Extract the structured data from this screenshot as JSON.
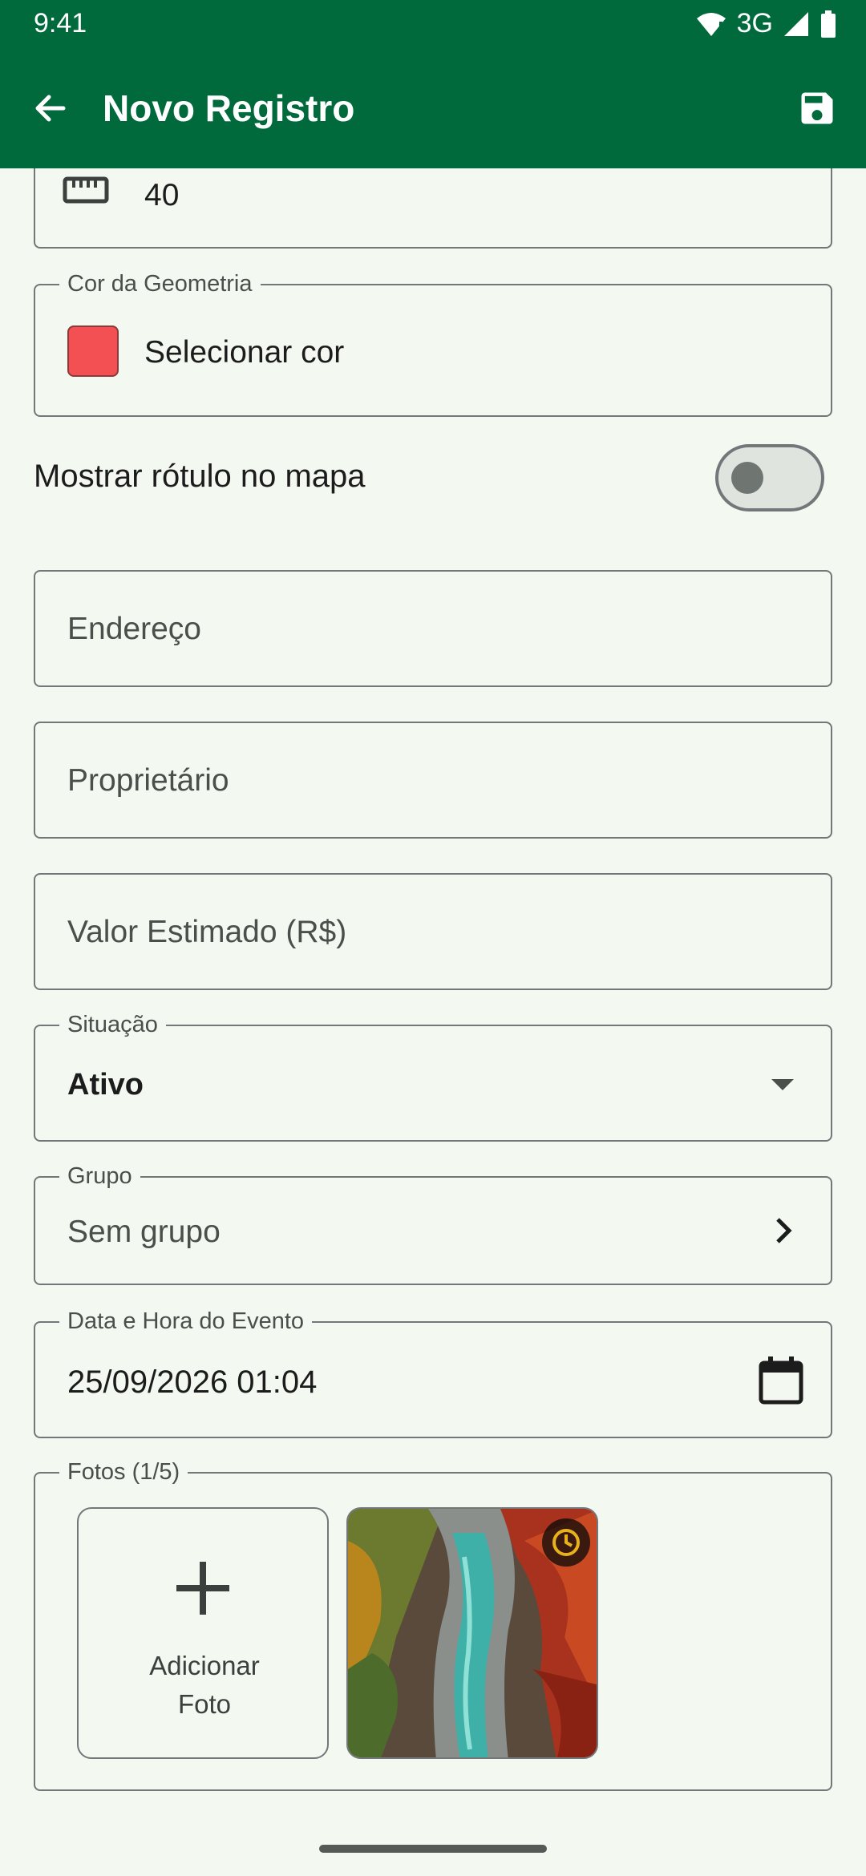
{
  "status_bar": {
    "time": "9:41",
    "network": "3G"
  },
  "app_bar": {
    "title": "Novo Registro"
  },
  "form": {
    "measure_value": "40",
    "color": {
      "legend": "Cor da Geometria",
      "label": "Selecionar cor",
      "value": "#f25052"
    },
    "show_label": {
      "label": "Mostrar rótulo no mapa",
      "checked": false
    },
    "endereco": {
      "placeholder": "Endereço"
    },
    "proprietario": {
      "placeholder": "Proprietário"
    },
    "valor": {
      "placeholder": "Valor Estimado (R$)"
    },
    "situacao": {
      "legend": "Situação",
      "value": "Ativo"
    },
    "grupo": {
      "legend": "Grupo",
      "value": "Sem grupo"
    },
    "data_hora": {
      "legend": "Data e Hora do Evento",
      "value": "25/09/2026 01:04"
    },
    "fotos": {
      "legend": "Fotos (1/5)",
      "add_label": "Adicionar Foto"
    }
  },
  "colors": {
    "primary": "#006a3c",
    "background": "#f3f8f1",
    "outline": "#73777a",
    "clock_badge": "#e8b21a"
  }
}
